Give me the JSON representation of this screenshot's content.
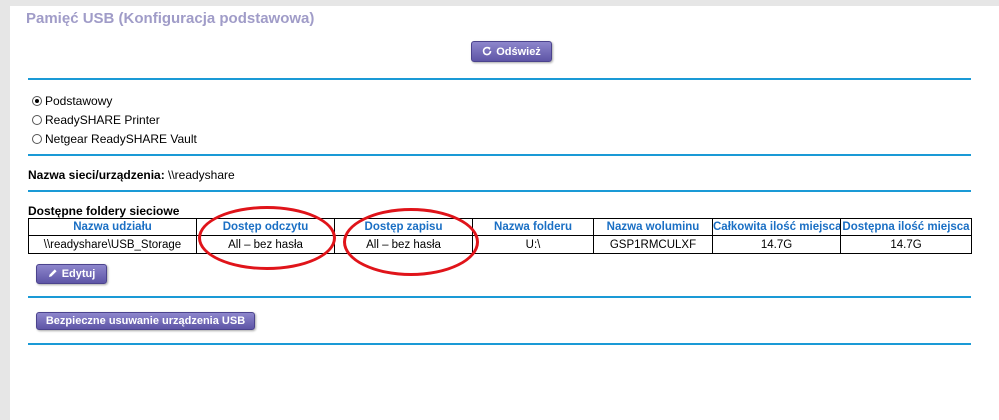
{
  "page": {
    "title": "Pamięć USB (Konfiguracja podstawowa)"
  },
  "toolbar": {
    "refresh_label": "Odśwież",
    "refresh_icon": "refresh-icon"
  },
  "modes": [
    {
      "label": "Podstawowy",
      "checked": true
    },
    {
      "label": "ReadySHARE Printer",
      "checked": false
    },
    {
      "label": "Netgear ReadySHARE Vault",
      "checked": false
    }
  ],
  "network": {
    "label": "Nazwa sieci/urządzenia:",
    "value": "\\\\readyshare"
  },
  "shares": {
    "title": "Dostępne foldery sieciowe",
    "columns": [
      "Nazwa udziału",
      "Dostęp odczytu",
      "Dostęp zapisu",
      "Nazwa folderu",
      "Nazwa woluminu",
      "Całkowita ilość miejsca",
      "Dostępna ilość miejsca"
    ],
    "rows": [
      [
        "\\\\readyshare\\USB_Storage",
        "All – bez hasła",
        "All – bez hasła",
        "U:\\",
        "GSP1RMCULXF",
        "14.7G",
        "14.7G"
      ]
    ]
  },
  "actions": {
    "edit_label": "Edytuj",
    "edit_icon": "pencil-icon",
    "remove_label": "Bezpieczne usuwanie urządzenia USB"
  },
  "colors": {
    "accent_line": "#1a9ad6",
    "button": "#6a62b3",
    "title": "#a09cc8",
    "header_text": "#1a6fc4",
    "annotation": "#e0141a"
  }
}
